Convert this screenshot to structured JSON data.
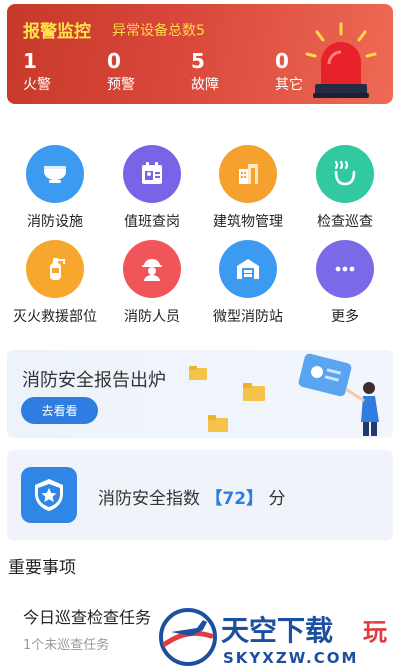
{
  "alarm": {
    "title": "报警监控",
    "subtitle": "异常设备总数5",
    "stats": [
      {
        "value": "1",
        "label": "火警"
      },
      {
        "value": "0",
        "label": "预警"
      },
      {
        "value": "5",
        "label": "故障"
      },
      {
        "value": "0",
        "label": "其它"
      }
    ],
    "colors": {
      "banner": "#d9483a",
      "title": "#ffe14a"
    }
  },
  "grid": {
    "items": [
      {
        "label": "消防设施",
        "icon": "fire-facility-icon",
        "color": "#3c9bf0"
      },
      {
        "label": "值班查岗",
        "icon": "duty-check-icon",
        "color": "#7a63e6"
      },
      {
        "label": "建筑物管理",
        "icon": "building-icon",
        "color": "#f5a12f"
      },
      {
        "label": "检查巡查",
        "icon": "inspection-icon",
        "color": "#33c9a0"
      },
      {
        "label": "灭火救援部位",
        "icon": "extinguisher-icon",
        "color": "#f7a72d"
      },
      {
        "label": "消防人员",
        "icon": "firefighter-icon",
        "color": "#f0555a"
      },
      {
        "label": "微型消防站",
        "icon": "mini-station-icon",
        "color": "#3c9bf0"
      },
      {
        "label": "更多",
        "icon": "more-icon",
        "color": "#7b6ae8"
      }
    ]
  },
  "report": {
    "title": "消防安全报告出炉",
    "button": "去看看"
  },
  "index": {
    "label": "消防安全指数",
    "value": "【72】",
    "unit": "分"
  },
  "important": {
    "title": "重要事项",
    "task_title": "今日巡查检查任务",
    "task_sub": "1个未巡查任务"
  },
  "watermark": {
    "cn": "天空下载",
    "cn_suffix": "玩",
    "en": "SKYXZW.COM"
  }
}
